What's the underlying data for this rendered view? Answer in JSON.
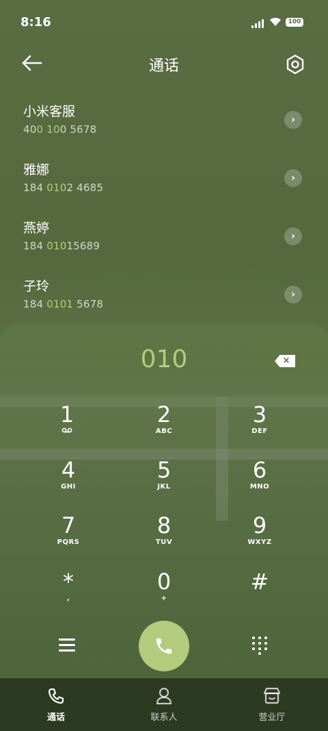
{
  "status": {
    "time": "8:16",
    "battery": "100"
  },
  "header": {
    "title": "通话",
    "back_icon": "arrow-left-icon",
    "settings_icon": "hexagon-settings-icon"
  },
  "contacts": [
    {
      "name": "小米客服",
      "num_pre": "40",
      "num_match": "0 10",
      "num_post": "0 5678"
    },
    {
      "name": "雅娜",
      "num_pre": "184 ",
      "num_match": "010",
      "num_post": "2 4685"
    },
    {
      "name": "燕婷",
      "num_pre": "184 ",
      "num_match": "010",
      "num_post": "15689"
    },
    {
      "name": "子玲",
      "num_pre": "184 ",
      "num_match": "0101",
      "num_post": " 5678"
    }
  ],
  "dialer": {
    "entry": "010",
    "keys": [
      {
        "digit": "1",
        "letters": ""
      },
      {
        "digit": "2",
        "letters": "ABC"
      },
      {
        "digit": "3",
        "letters": "DEF"
      },
      {
        "digit": "4",
        "letters": "GHI"
      },
      {
        "digit": "5",
        "letters": "JKL"
      },
      {
        "digit": "6",
        "letters": "MNO"
      },
      {
        "digit": "7",
        "letters": "PQRS"
      },
      {
        "digit": "8",
        "letters": "TUV"
      },
      {
        "digit": "9",
        "letters": "WXYZ"
      },
      {
        "digit": "*",
        "letters": ","
      },
      {
        "digit": "0",
        "letters": "+"
      },
      {
        "digit": "#",
        "letters": ""
      }
    ]
  },
  "tabs": [
    {
      "label": "通话",
      "icon": "phone-icon",
      "active": true
    },
    {
      "label": "联系人",
      "icon": "person-icon",
      "active": false
    },
    {
      "label": "营业厅",
      "icon": "store-icon",
      "active": false
    }
  ],
  "colors": {
    "accent": "#b3cb7d",
    "tabbar": "#2c3a22"
  }
}
